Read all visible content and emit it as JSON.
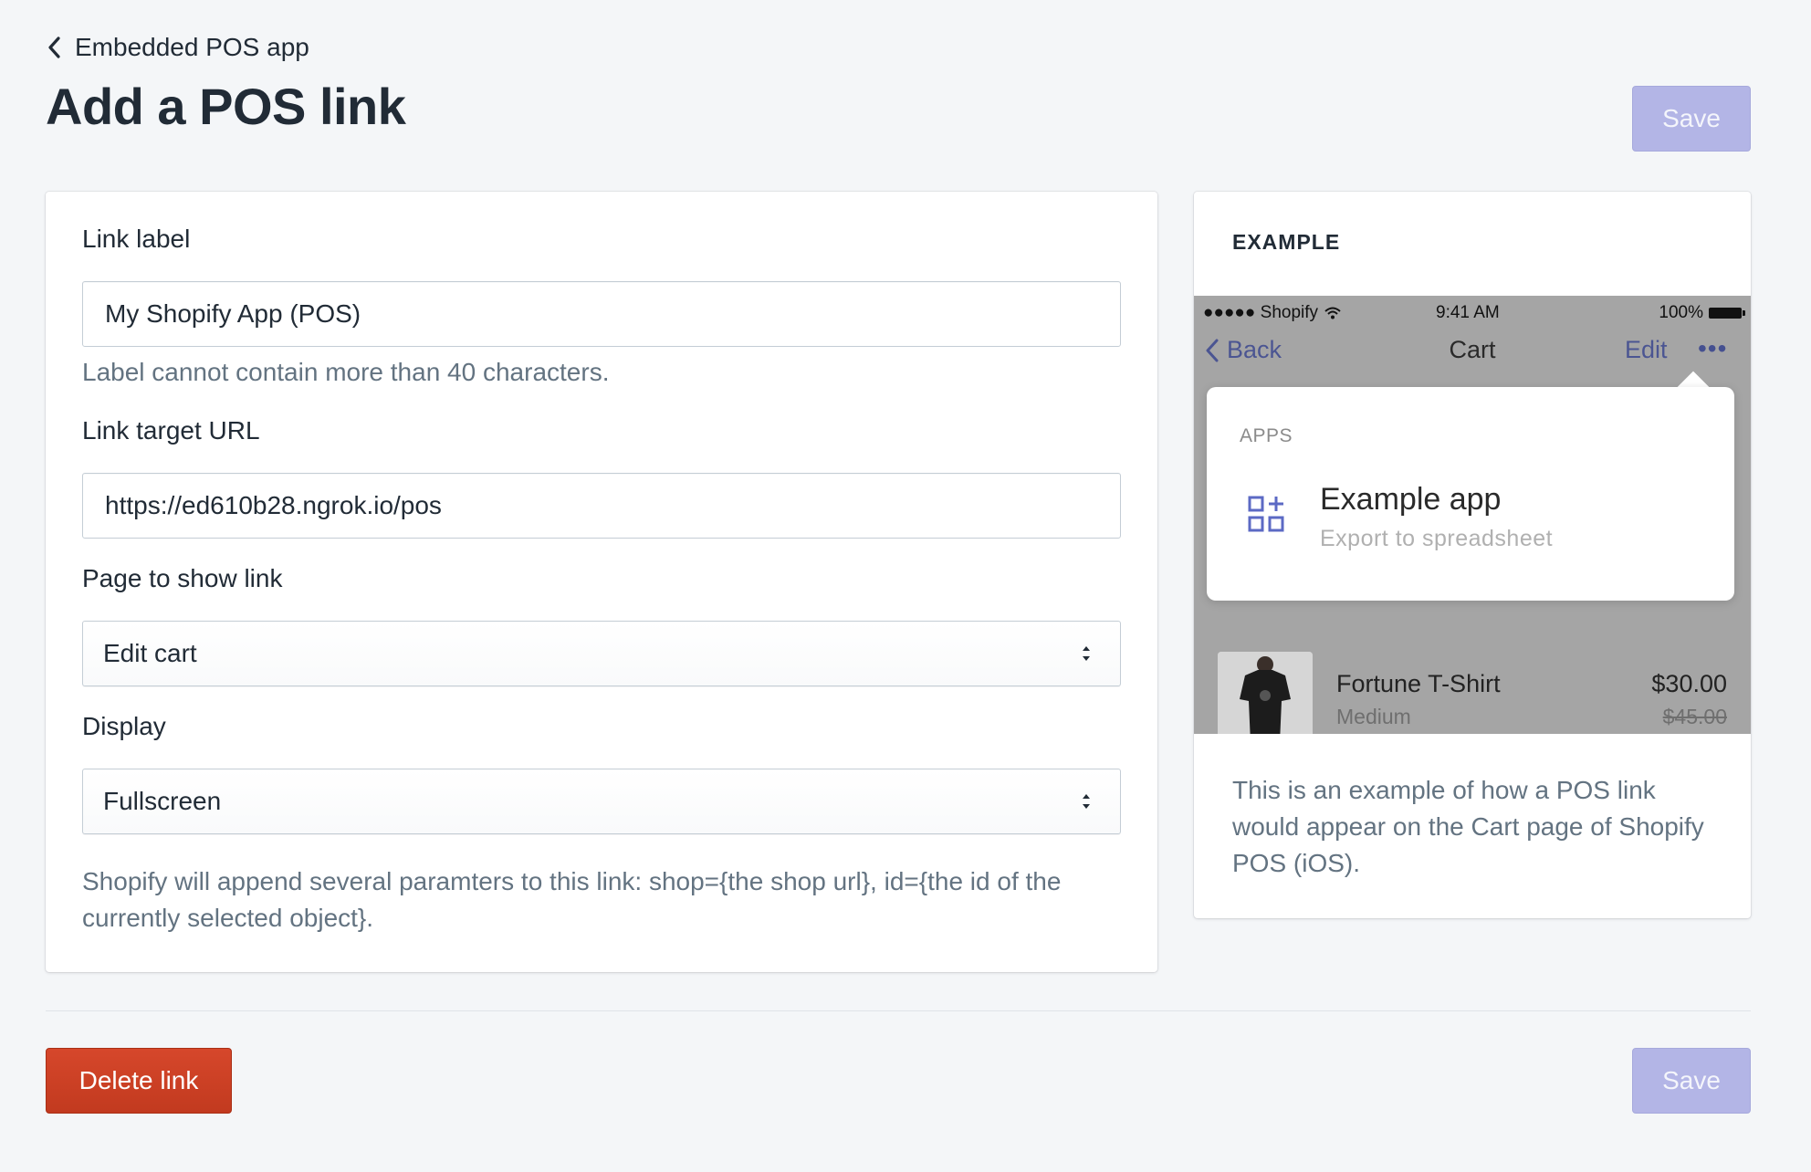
{
  "breadcrumb": {
    "label": "Embedded POS app"
  },
  "page": {
    "title": "Add a POS link"
  },
  "actions": {
    "save_label": "Save",
    "delete_label": "Delete link"
  },
  "form": {
    "link_label": {
      "label": "Link label",
      "value": "My Shopify App (POS)",
      "help": "Label cannot contain more than 40 characters."
    },
    "link_url": {
      "label": "Link target URL",
      "value": "https://ed610b28.ngrok.io/pos"
    },
    "page_select": {
      "label": "Page to show link",
      "selected": "Edit cart"
    },
    "display_select": {
      "label": "Display",
      "selected": "Fullscreen"
    },
    "params_help": "Shopify will append several paramters to this link: shop={the shop url}, id={the id of the currently selected object}."
  },
  "example": {
    "heading": "EXAMPLE",
    "status": {
      "carrier": "●●●●● Shopify",
      "time": "9:41 AM",
      "battery": "100%"
    },
    "nav": {
      "back": "Back",
      "title": "Cart",
      "edit": "Edit",
      "more": "•••"
    },
    "popover": {
      "section": "APPS",
      "app_name": "Example app",
      "app_subtitle": "Export to spreadsheet",
      "icon": "apps-grid-icon"
    },
    "product": {
      "name": "Fortune T-Shirt",
      "variant": "Medium",
      "price": "$30.00",
      "compare_price": "$45.00"
    },
    "description": "This is an example of how a POS link would appear on the Cart page of Shopify POS (iOS)."
  },
  "colors": {
    "background": "#f4f6f8",
    "primary_disabled": "#b3b5e6",
    "destructive": "#d13f22",
    "text": "#212b36",
    "subdued": "#637381",
    "ios_tint": "#2e3b8c"
  }
}
